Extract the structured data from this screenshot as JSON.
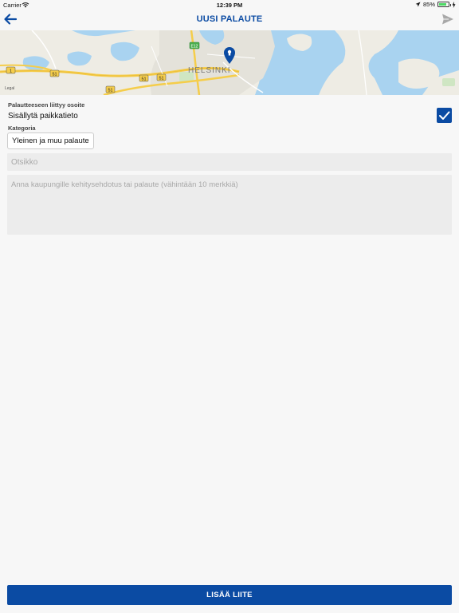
{
  "status_bar": {
    "carrier": "Carrier",
    "time": "12:39 PM",
    "battery_percent": "85%",
    "battery_level": 0.85,
    "icons": [
      "wifi-icon",
      "location-arrow-icon",
      "battery-icon",
      "charging-bolt-icon"
    ]
  },
  "navbar": {
    "title": "UUSI PALAUTE",
    "back_icon": "arrow-left-icon",
    "send_icon": "paper-plane-icon"
  },
  "map": {
    "city_label": "HELSINKI",
    "legal_label": "Legal",
    "road_signs": [
      "1",
      "51",
      "51",
      "51",
      "51",
      "E12"
    ],
    "marker_icon": "map-pin-icon"
  },
  "form": {
    "address_label": "Palautteeseen liittyy osoite",
    "location_label": "Sisällytä paikkatieto",
    "location_checked": true,
    "category_label": "Kategoria",
    "category_value": "Yleinen ja muu palaute",
    "title_placeholder": "Otsikko",
    "title_value": "",
    "description_placeholder": "Anna kaupungille kehitysehdotus tai palaute (vähintään 10 merkkiä)",
    "description_value": ""
  },
  "footer": {
    "attach_label": "LISÄÄ LIITE"
  },
  "colors": {
    "accent": "#0b4ba3",
    "water": "#a9d3f0",
    "land": "#eeece4",
    "road": "#f5cd4a"
  }
}
